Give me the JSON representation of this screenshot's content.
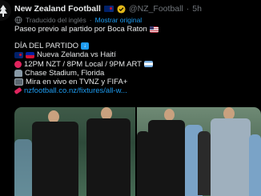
{
  "tweet": {
    "author_name": "New Zealand Football",
    "handle": "@NZ_Football",
    "separator": "·",
    "time": "5h",
    "translation_note": "Traducido del inglés",
    "show_original": "Mostrar original",
    "lines": [
      "Paseo previo al partido por Boca Raton",
      "",
      "DÍA DEL PARTIDO",
      "Nueva Zelanda vs Haití",
      "12PM NZT / 8PM Local / 9PM ART",
      "Chase Stadium, Florida",
      "Mira en vivo en TVNZ y FIFA+",
      "nzfootball.co.nz/fixtures/all-w..."
    ]
  },
  "colors": {
    "background": "#000000",
    "text": "#e7e9ea",
    "muted": "#71767b",
    "link": "#1d9bf0"
  }
}
